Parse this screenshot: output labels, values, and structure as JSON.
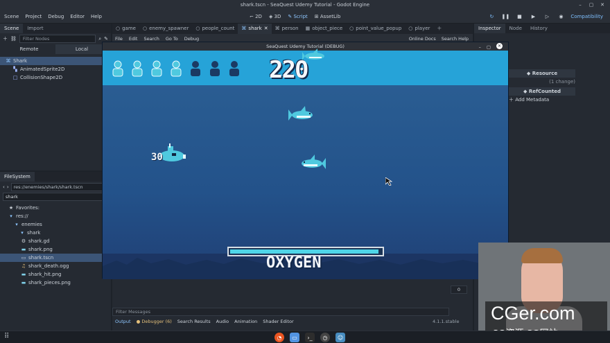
{
  "window": {
    "title": "shark.tscn - SeaQuest Udemy Tutorial - Godot Engine"
  },
  "menu": {
    "items": [
      "Scene",
      "Project",
      "Debug",
      "Editor",
      "Help"
    ]
  },
  "workspaces": {
    "items": [
      "2D",
      "3D",
      "Script",
      "AssetLib"
    ],
    "active": "Script"
  },
  "renderer": "Compatibility",
  "scene_dock": {
    "tabs": [
      "Scene",
      "Import"
    ],
    "filter_placeholder": "Filter Nodes",
    "remote": "Remote",
    "local": "Local",
    "nodes": [
      "Shark",
      "AnimatedSprite2D",
      "CollisionShape2D"
    ]
  },
  "filesystem": {
    "tab": "FileSystem",
    "path": "res://enemies/shark/shark.tscn",
    "search": "shark",
    "tree": [
      "Favorites:",
      "res://",
      "enemies",
      "shark",
      "shark.gd",
      "shark.png",
      "shark.tscn",
      "shark_death.ogg",
      "shark_hit.png",
      "shark_pieces.png"
    ]
  },
  "scene_tabs": [
    "game",
    "enemy_spawner",
    "people_count",
    "shark",
    "person",
    "object_piece",
    "point_value_popup",
    "player"
  ],
  "editor_toolbar": {
    "items": [
      "File",
      "Edit",
      "Search",
      "Go To",
      "Debug"
    ],
    "online_docs": "Online Docs",
    "search_help": "Search Help"
  },
  "inspector": {
    "tabs": [
      "Inspector",
      "Node",
      "History"
    ],
    "resource": "Resource",
    "changes": "(1 change)",
    "refcounted": "RefCounted",
    "add_metadata": "Add Metadata"
  },
  "game": {
    "window_title": "SeaQuest Udemy Tutorial (DEBUG)",
    "score": "220",
    "people_total": 7,
    "people_filled": 4,
    "points_popup": "30",
    "oxygen_label": "OXYGEN",
    "oxygen_level": 0.98
  },
  "bottom_panel": {
    "filter_placeholder": "Filter Messages",
    "tabs": [
      "Output",
      "Debugger (6)",
      "Search Results",
      "Audio",
      "Animation",
      "Shader Editor"
    ],
    "version": "4.1.1.stable",
    "counter": "0"
  },
  "watermark": {
    "line1": "CGer.com",
    "line2": "CG资源 CG网站"
  },
  "colors": {
    "accent": "#8fc7ff",
    "sky": "#26a3d8",
    "water": "#23528a",
    "shark": "#4fc9df"
  }
}
